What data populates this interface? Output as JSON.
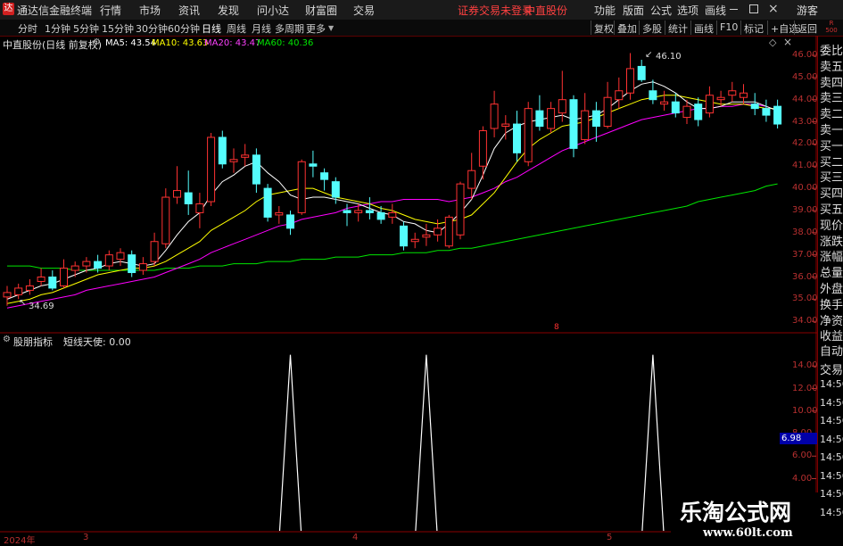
{
  "app": {
    "title": "通达信金融终端",
    "logo": "logo-icon"
  },
  "menu": [
    "行情",
    "市场",
    "资讯",
    "发现",
    "问小达",
    "财富圈",
    "交易"
  ],
  "menu_notice": "证券交易未登录",
  "menu_stock": "中直股份",
  "menu_right": [
    "功能",
    "版面",
    "公式",
    "选项",
    "画线"
  ],
  "window_controls": [
    "minimize-icon",
    "maximize-icon",
    "close-icon"
  ],
  "guest": "游客",
  "periods": [
    "分时",
    "1分钟",
    "5分钟",
    "15分钟",
    "30分钟",
    "60分钟",
    "日线",
    "周线",
    "月线",
    "多周期",
    "更多"
  ],
  "active_period": "日线",
  "toolbar_right": [
    "复权",
    "叠加",
    "多股",
    "统计",
    "画线",
    "F10",
    "标记",
    "+自选",
    "返回"
  ],
  "rank": {
    "line1": "R",
    "line2": "500"
  },
  "chart_info": {
    "stock": "中直股份(日线 前复权)",
    "ma5": "MA5: 43.54",
    "ma10": "MA10: 43.63",
    "ma20": "MA20: 43.47",
    "ma60": "MA60: 40.36"
  },
  "price_axis": [
    "46.00",
    "45.00",
    "44.00",
    "43.00",
    "42.00",
    "41.00",
    "40.00",
    "39.00",
    "38.00",
    "37.00",
    "36.00",
    "35.00",
    "34.00"
  ],
  "high_label": "46.10",
  "low_label": "34.69",
  "sub_panel": {
    "title": "股朋指标",
    "line": "短线天使: 0.00"
  },
  "sub_axis": [
    "14.00",
    "12.00",
    "10.00",
    "8.00",
    "6.00",
    "4.00"
  ],
  "sub_marker": "6.98",
  "side_quote": [
    "委比",
    "卖五",
    "卖四",
    "卖三",
    "卖二",
    "卖一",
    "买一",
    "买二",
    "买三",
    "买四",
    "买五",
    "现价",
    "涨跌",
    "涨幅",
    "总量",
    "外盘",
    "换手",
    "净资",
    "收益"
  ],
  "side_trade": [
    "自动",
    "交易",
    "14:56",
    "14:56",
    "14:56",
    "14:56",
    "14:56",
    "14:56",
    "14:56",
    "14:56"
  ],
  "dates": [
    "2024年",
    "3",
    "4",
    "5"
  ],
  "watermark": {
    "title": "乐淘公式网",
    "url": "www.60lt.com"
  },
  "colors": {
    "up": "#ff3232",
    "down": "#54fcfc",
    "ma5": "#ffffff",
    "ma10": "#ffff00",
    "ma20": "#ff00ff",
    "ma60": "#00e600",
    "axis": "#b83030"
  },
  "chart_data": {
    "type": "candlestick",
    "ylim": [
      34,
      46.5
    ],
    "candles": [
      {
        "o": 35.1,
        "c": 35.3,
        "h": 35.6,
        "l": 34.7
      },
      {
        "o": 35.2,
        "c": 35.5,
        "h": 35.7,
        "l": 35.0
      },
      {
        "o": 35.4,
        "c": 35.6,
        "h": 35.9,
        "l": 35.2
      },
      {
        "o": 35.8,
        "c": 36.0,
        "h": 36.4,
        "l": 35.6
      },
      {
        "o": 36.0,
        "c": 35.5,
        "h": 36.3,
        "l": 35.4
      },
      {
        "o": 35.6,
        "c": 36.4,
        "h": 36.8,
        "l": 35.5
      },
      {
        "o": 36.3,
        "c": 36.5,
        "h": 36.7,
        "l": 36.0
      },
      {
        "o": 36.5,
        "c": 36.7,
        "h": 36.9,
        "l": 36.2
      },
      {
        "o": 36.7,
        "c": 36.4,
        "h": 37.0,
        "l": 36.2
      },
      {
        "o": 36.5,
        "c": 37.0,
        "h": 37.2,
        "l": 36.3
      },
      {
        "o": 36.8,
        "c": 37.1,
        "h": 37.3,
        "l": 36.5
      },
      {
        "o": 37.0,
        "c": 36.2,
        "h": 37.2,
        "l": 36.0
      },
      {
        "o": 36.3,
        "c": 36.6,
        "h": 36.9,
        "l": 36.1
      },
      {
        "o": 36.7,
        "c": 37.6,
        "h": 38.0,
        "l": 36.5
      },
      {
        "o": 37.5,
        "c": 39.6,
        "h": 40.0,
        "l": 37.3
      },
      {
        "o": 39.6,
        "c": 39.9,
        "h": 41.0,
        "l": 39.3
      },
      {
        "o": 39.8,
        "c": 39.3,
        "h": 40.8,
        "l": 38.8
      },
      {
        "o": 38.9,
        "c": 39.3,
        "h": 39.8,
        "l": 38.2
      },
      {
        "o": 39.4,
        "c": 42.3,
        "h": 42.5,
        "l": 39.2
      },
      {
        "o": 42.3,
        "c": 41.1,
        "h": 42.6,
        "l": 40.9
      },
      {
        "o": 41.2,
        "c": 41.3,
        "h": 41.8,
        "l": 40.7
      },
      {
        "o": 41.4,
        "c": 41.5,
        "h": 42.0,
        "l": 41.0
      },
      {
        "o": 41.5,
        "c": 40.2,
        "h": 41.8,
        "l": 39.8
      },
      {
        "o": 40.0,
        "c": 38.7,
        "h": 40.2,
        "l": 38.5
      },
      {
        "o": 38.8,
        "c": 38.9,
        "h": 39.2,
        "l": 38.4
      },
      {
        "o": 38.8,
        "c": 38.2,
        "h": 39.0,
        "l": 37.9
      },
      {
        "o": 38.9,
        "c": 41.2,
        "h": 41.3,
        "l": 38.8
      },
      {
        "o": 41.1,
        "c": 41.0,
        "h": 41.7,
        "l": 40.5
      },
      {
        "o": 40.7,
        "c": 40.4,
        "h": 40.9,
        "l": 39.9
      },
      {
        "o": 40.3,
        "c": 39.6,
        "h": 40.5,
        "l": 39.3
      },
      {
        "o": 39.0,
        "c": 38.9,
        "h": 39.3,
        "l": 38.3
      },
      {
        "o": 38.9,
        "c": 39.0,
        "h": 39.3,
        "l": 38.5
      },
      {
        "o": 39.0,
        "c": 38.9,
        "h": 39.6,
        "l": 38.6
      },
      {
        "o": 38.9,
        "c": 38.6,
        "h": 39.2,
        "l": 38.4
      },
      {
        "o": 38.7,
        "c": 38.9,
        "h": 39.3,
        "l": 38.4
      },
      {
        "o": 38.3,
        "c": 37.4,
        "h": 38.5,
        "l": 37.2
      },
      {
        "o": 37.6,
        "c": 37.7,
        "h": 38.0,
        "l": 37.3
      },
      {
        "o": 37.8,
        "c": 37.9,
        "h": 38.4,
        "l": 37.4
      },
      {
        "o": 37.9,
        "c": 38.2,
        "h": 38.6,
        "l": 37.6
      },
      {
        "o": 37.4,
        "c": 38.7,
        "h": 38.8,
        "l": 37.3
      },
      {
        "o": 37.9,
        "c": 40.2,
        "h": 40.3,
        "l": 37.7
      },
      {
        "o": 40.0,
        "c": 40.8,
        "h": 41.6,
        "l": 39.5
      },
      {
        "o": 41.0,
        "c": 42.6,
        "h": 42.8,
        "l": 40.4
      },
      {
        "o": 42.7,
        "c": 43.8,
        "h": 44.4,
        "l": 42.3
      },
      {
        "o": 42.8,
        "c": 42.9,
        "h": 43.3,
        "l": 42.2
      },
      {
        "o": 42.9,
        "c": 41.6,
        "h": 43.5,
        "l": 41.2
      },
      {
        "o": 41.2,
        "c": 43.6,
        "h": 43.9,
        "l": 41.0
      },
      {
        "o": 43.5,
        "c": 42.8,
        "h": 44.2,
        "l": 42.6
      },
      {
        "o": 42.7,
        "c": 43.6,
        "h": 43.9,
        "l": 42.5
      },
      {
        "o": 43.4,
        "c": 44.0,
        "h": 45.3,
        "l": 43.0
      },
      {
        "o": 44.0,
        "c": 41.8,
        "h": 44.2,
        "l": 41.4
      },
      {
        "o": 42.2,
        "c": 43.5,
        "h": 44.3,
        "l": 42.0
      },
      {
        "o": 43.5,
        "c": 42.8,
        "h": 43.9,
        "l": 42.1
      },
      {
        "o": 42.8,
        "c": 44.1,
        "h": 44.8,
        "l": 42.7
      },
      {
        "o": 44.0,
        "c": 44.4,
        "h": 45.0,
        "l": 43.6
      },
      {
        "o": 44.3,
        "c": 45.4,
        "h": 46.1,
        "l": 44.0
      },
      {
        "o": 45.5,
        "c": 44.9,
        "h": 45.8,
        "l": 44.8
      },
      {
        "o": 44.4,
        "c": 44.0,
        "h": 44.9,
        "l": 43.8
      },
      {
        "o": 43.8,
        "c": 43.9,
        "h": 44.4,
        "l": 43.5
      },
      {
        "o": 43.9,
        "c": 43.4,
        "h": 44.3,
        "l": 43.2
      },
      {
        "o": 43.2,
        "c": 43.7,
        "h": 44.0,
        "l": 42.9
      },
      {
        "o": 43.8,
        "c": 43.1,
        "h": 44.1,
        "l": 42.8
      },
      {
        "o": 43.4,
        "c": 44.2,
        "h": 44.6,
        "l": 43.2
      },
      {
        "o": 44.0,
        "c": 44.1,
        "h": 44.4,
        "l": 43.7
      },
      {
        "o": 44.2,
        "c": 44.4,
        "h": 44.8,
        "l": 43.9
      },
      {
        "o": 44.1,
        "c": 44.3,
        "h": 44.7,
        "l": 43.8
      },
      {
        "o": 43.8,
        "c": 43.6,
        "h": 44.3,
        "l": 43.3
      },
      {
        "o": 43.6,
        "c": 43.3,
        "h": 44.0,
        "l": 43.0
      },
      {
        "o": 43.7,
        "c": 42.9,
        "h": 44.0,
        "l": 42.7
      }
    ],
    "ma5": [
      35.0,
      35.2,
      35.4,
      35.6,
      35.7,
      35.9,
      36.1,
      36.3,
      36.4,
      36.6,
      36.7,
      36.6,
      36.5,
      36.6,
      37.2,
      37.9,
      38.5,
      38.9,
      39.7,
      40.3,
      40.6,
      41.0,
      41.2,
      40.7,
      40.3,
      39.7,
      39.5,
      39.6,
      39.6,
      39.5,
      39.4,
      39.3,
      39.1,
      38.9,
      38.8,
      38.5,
      38.4,
      38.1,
      38.0,
      38.4,
      38.9,
      39.5,
      40.6,
      41.8,
      42.5,
      42.8,
      43.0,
      43.1,
      43.2,
      43.3,
      43.1,
      43.2,
      43.3,
      43.6,
      44.0,
      44.4,
      44.7,
      44.8,
      44.6,
      44.3,
      43.9,
      43.6,
      43.6,
      43.7,
      43.9,
      43.9,
      43.9,
      43.7,
      43.5
    ],
    "ma10": [
      34.8,
      34.9,
      35.0,
      35.2,
      35.3,
      35.5,
      35.7,
      35.9,
      36.1,
      36.2,
      36.3,
      36.4,
      36.4,
      36.5,
      36.7,
      37.0,
      37.3,
      37.6,
      38.1,
      38.4,
      38.7,
      39.0,
      39.4,
      39.7,
      39.8,
      39.9,
      40.0,
      40.0,
      39.8,
      39.6,
      39.5,
      39.4,
      39.3,
      39.1,
      39.0,
      38.8,
      38.6,
      38.5,
      38.4,
      38.5,
      38.6,
      38.8,
      39.3,
      39.8,
      40.5,
      41.2,
      41.8,
      42.2,
      42.5,
      42.8,
      42.9,
      43.0,
      43.2,
      43.4,
      43.6,
      43.8,
      44.0,
      44.1,
      44.2,
      44.2,
      44.1,
      44.0,
      43.9,
      43.8,
      43.8,
      43.8,
      43.7,
      43.6,
      43.6
    ],
    "ma20": [
      34.6,
      34.7,
      34.8,
      34.9,
      35.0,
      35.1,
      35.2,
      35.4,
      35.5,
      35.6,
      35.7,
      35.8,
      35.9,
      36.0,
      36.2,
      36.4,
      36.6,
      36.8,
      37.1,
      37.3,
      37.5,
      37.7,
      37.9,
      38.1,
      38.3,
      38.4,
      38.6,
      38.7,
      38.8,
      38.9,
      39.1,
      39.2,
      39.3,
      39.4,
      39.4,
      39.5,
      39.5,
      39.5,
      39.5,
      39.4,
      39.5,
      39.6,
      39.8,
      40.0,
      40.3,
      40.5,
      40.8,
      41.1,
      41.4,
      41.7,
      41.9,
      42.1,
      42.3,
      42.5,
      42.7,
      42.9,
      43.1,
      43.2,
      43.3,
      43.4,
      43.5,
      43.6,
      43.6,
      43.7,
      43.7,
      43.8,
      43.8,
      43.7,
      43.5
    ],
    "ma60": [
      36.5,
      36.5,
      36.5,
      36.4,
      36.4,
      36.4,
      36.3,
      36.3,
      36.3,
      36.3,
      36.3,
      36.3,
      36.3,
      36.3,
      36.4,
      36.4,
      36.4,
      36.5,
      36.5,
      36.5,
      36.6,
      36.6,
      36.6,
      36.7,
      36.7,
      36.7,
      36.8,
      36.8,
      36.8,
      36.9,
      36.9,
      36.9,
      37.0,
      37.0,
      37.0,
      37.1,
      37.1,
      37.1,
      37.2,
      37.2,
      37.3,
      37.3,
      37.4,
      37.5,
      37.6,
      37.7,
      37.8,
      37.9,
      38.0,
      38.1,
      38.2,
      38.3,
      38.4,
      38.5,
      38.6,
      38.7,
      38.8,
      38.9,
      39.0,
      39.1,
      39.2,
      39.4,
      39.5,
      39.6,
      39.7,
      39.8,
      39.9,
      40.1,
      40.2
    ],
    "sub_indicator": {
      "name": "短线天使",
      "spikes_at": [
        25,
        37,
        57
      ],
      "spike_value": 15,
      "base": 0,
      "ylim": [
        0,
        16
      ]
    }
  }
}
